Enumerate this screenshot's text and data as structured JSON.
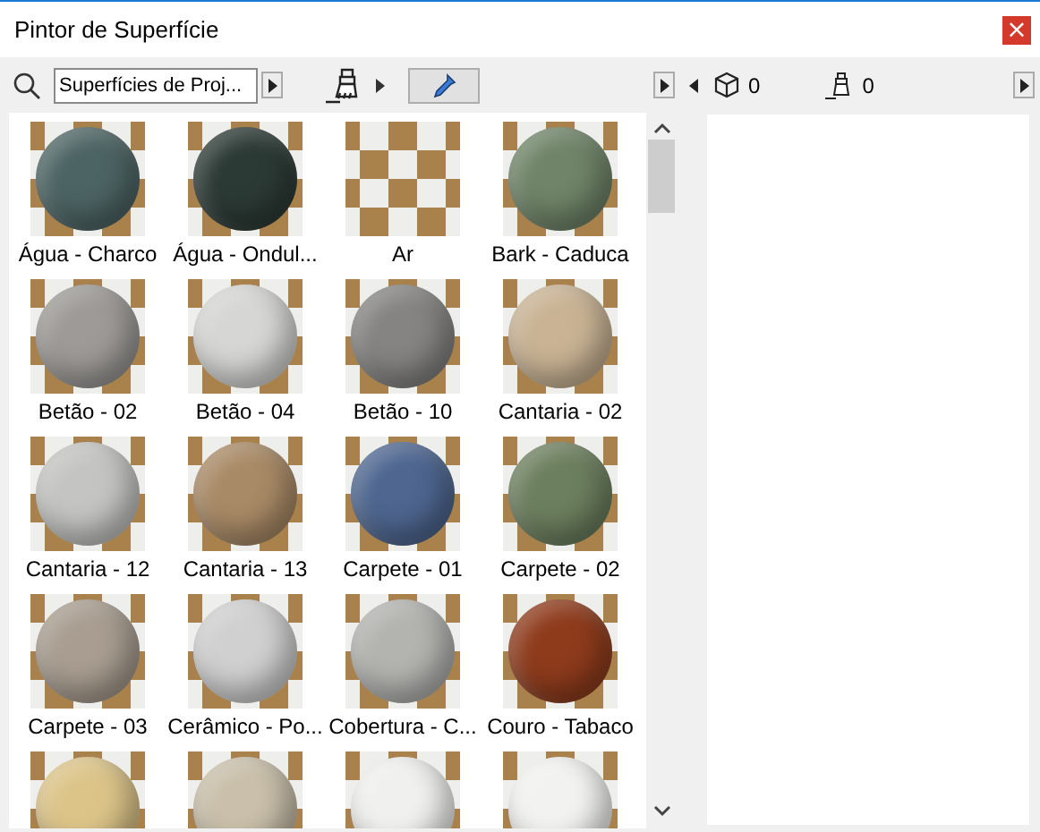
{
  "window": {
    "title": "Pintor de Superfície",
    "close": "×"
  },
  "toolbar": {
    "library": {
      "value": "Superfícies de Proj..."
    }
  },
  "materials": [
    {
      "label": "Água - Charco",
      "color": "#4d6464"
    },
    {
      "label": "Água - Ondul...",
      "color": "#2c3a36"
    },
    {
      "label": "Ar"
    },
    {
      "label": "Bark - Caduca",
      "color": "#6f8468"
    },
    {
      "label": "Betão - 02",
      "color": "#9d9a97"
    },
    {
      "label": "Betão - 04",
      "color": "#d6d6d4"
    },
    {
      "label": "Betão - 10",
      "color": "#858483"
    },
    {
      "label": "Cantaria - 02",
      "color": "#c9b394"
    },
    {
      "label": "Cantaria - 12",
      "color": "#c4c4c2"
    },
    {
      "label": "Cantaria - 13",
      "color": "#a98a66"
    },
    {
      "label": "Carpete - 01",
      "color": "#4e6690"
    },
    {
      "label": "Carpete - 02",
      "color": "#6c7f5e"
    },
    {
      "label": "Carpete - 03",
      "color": "#a89d90"
    },
    {
      "label": "Cerâmico - Po...",
      "color": "#d0d0d0"
    },
    {
      "label": "Cobertura - C...",
      "color": "#b3b3b0"
    },
    {
      "label": "Couro - Tabaco",
      "color": "#8e3b1c"
    },
    {
      "color": "#dcc489"
    },
    {
      "color": "#c9bfaa"
    },
    {
      "color": "#f0f0ee"
    },
    {
      "color": "#f2f2f0"
    }
  ],
  "counts": {
    "elements": "0",
    "surfaces": "0"
  }
}
